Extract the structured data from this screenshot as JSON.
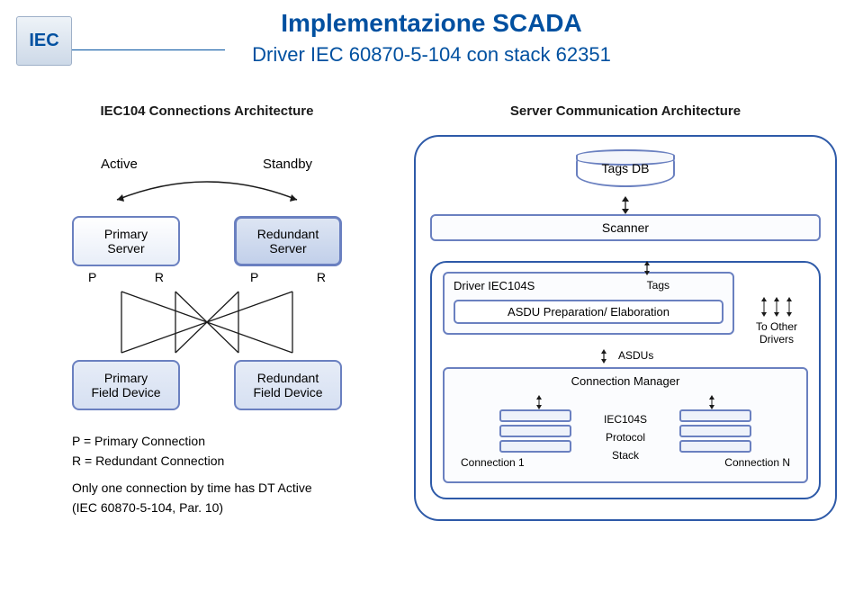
{
  "logo": "IEC",
  "title": "Implementazione SCADA",
  "subtitle": "Driver IEC 60870-5-104 con stack 62351",
  "left": {
    "heading": "IEC104 Connections Architecture",
    "active": "Active",
    "standby": "Standby",
    "primary_server": {
      "line1": "Primary",
      "line2": "Server"
    },
    "redundant_server": {
      "line1": "Redundant",
      "line2": "Server"
    },
    "p": "P",
    "r": "R",
    "primary_field": {
      "line1": "Primary",
      "line2": "Field Device"
    },
    "redundant_field": {
      "line1": "Redundant",
      "line2": "Field Device"
    },
    "legend_p": "P = Primary Connection",
    "legend_r": "R = Redundant Connection",
    "note1": "Only one connection by time has DT Active",
    "note2": "(IEC 60870-5-104, Par. 10)"
  },
  "right": {
    "heading": "Server Communication Architecture",
    "tagsdb": "Tags DB",
    "scanner": "Scanner",
    "driver_title": "Driver IEC104S",
    "tags": "Tags",
    "asdu_prep": "ASDU Preparation/ Elaboration",
    "asdus": "ASDUs",
    "to_other": "To Other Drivers",
    "conn_mgr": "Connection Manager",
    "stack_l1": "IEC104S",
    "stack_l2": "Protocol",
    "stack_l3": "Stack",
    "conn1": "Connection 1",
    "connN": "Connection N"
  }
}
